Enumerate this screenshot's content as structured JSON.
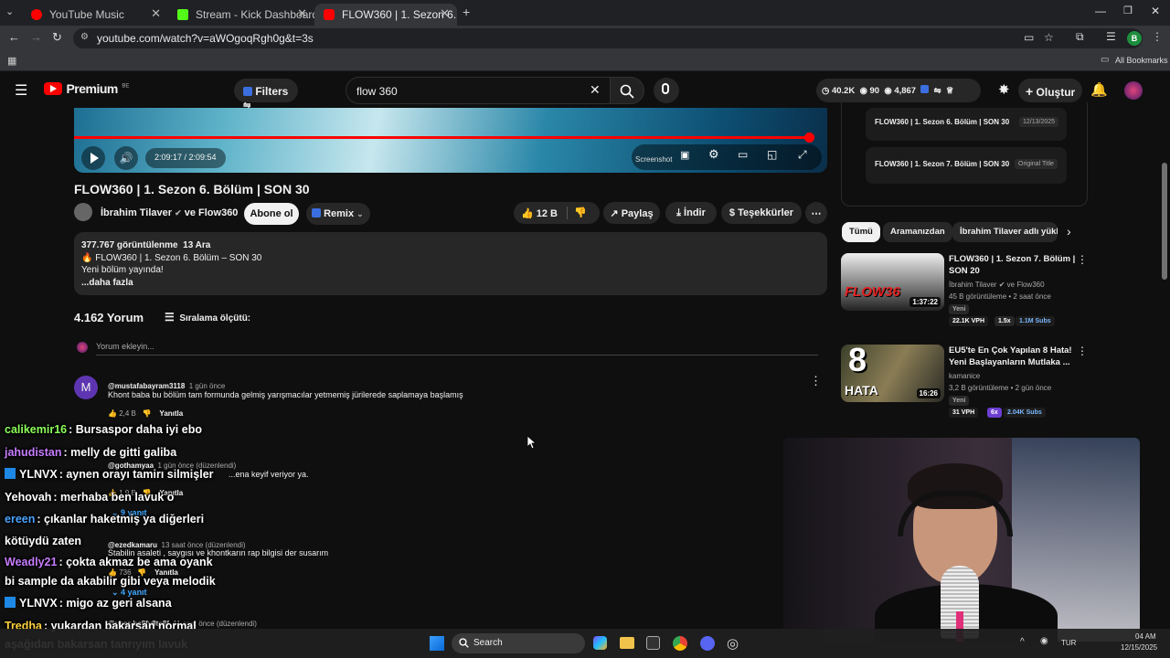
{
  "browser": {
    "tabs": [
      {
        "label": "YouTube Music"
      },
      {
        "label": "Stream - Kick Dashboard"
      },
      {
        "label": "FLOW360 | 1. Sezon 6. Bölüm |"
      }
    ],
    "url": "youtube.com/watch?v=aWOgoqRgh0g&t=3s",
    "bookmarks_label": "All Bookmarks",
    "profile_initial": "B"
  },
  "youtube": {
    "logo_text": "Premium",
    "logo_badge": "BE",
    "filters_label": "Filters",
    "search_value": "flow 360",
    "stats": {
      "views": "40.2K",
      "viewers": "90",
      "count": "4,867"
    },
    "create_label": "Oluştur"
  },
  "player": {
    "time": "2:09:17 / 2:09:54",
    "screenshot_label": "Screenshot",
    "progress_fraction": 0.99
  },
  "video": {
    "title": "FLOW360 | 1. Sezon 6. Bölüm | SON 30",
    "channel": "İbrahim Tilaver",
    "collab": "ve Flow360",
    "subscribe_label": "Abone ol",
    "remix_label": "Remix",
    "likes": "12 B",
    "share_label": "Paylaş",
    "download_label": "İndir",
    "thanks_label": "Teşekkürler"
  },
  "description": {
    "views": "377.767 görüntülenme",
    "date": "13 Ara",
    "line1": "🔥 FLOW360 | 1. Sezon 6. Bölüm – SON 30",
    "line2": "Yeni bölüm yayında!",
    "more": "...daha fazla"
  },
  "comments": {
    "count": "4.162 Yorum",
    "sort_label": "Sıralama ölçütü:",
    "add_placeholder": "Yorum ekleyin...",
    "items": [
      {
        "avatar": "M",
        "user": "@mustafabayram3118",
        "time": "1 gün önce",
        "text": "Khont baba bu bölüm tam formunda gelmiş yarışmacılar yetmemiş jürilerede saplamaya başlamış",
        "likes": "2,4 B",
        "reply": "Yanıtla"
      },
      {
        "user": "@gothamyaa",
        "time": "1 gün önce (düzenlendi)",
        "text": "...ena keyif veriyor ya.",
        "likes": "1,9 B",
        "reply": "Yanıtla",
        "replies": "9 yanıt"
      },
      {
        "user": "@ezedkamaru",
        "time": "13 saat önce (düzenlendi)",
        "text": "Stabilin asaleti , saygısı ve khontkarın rap bilgisi der susarım",
        "likes": "736",
        "reply": "Yanıtla",
        "replies": "4 yanıt"
      },
      {
        "user": "@user-bc8fy8te8f",
        "time": "11 saat önce (düzenlendi)"
      }
    ]
  },
  "chat": [
    {
      "user": "calikemir16",
      "color": "#8cff5a",
      "msg": ": Bursaspor daha iyi ebo",
      "badge": false
    },
    {
      "user": "jahudistan",
      "color": "#c77dff",
      "msg": ": melly de gitti galiba",
      "badge": false
    },
    {
      "user": "YLNVX",
      "color": "#ffffff",
      "msg": ": aynen orayı tamirı silmişler",
      "badge": true
    },
    {
      "user": "Yehovah",
      "color": "#ffffff",
      "msg": ": merhaba ben lavuk o",
      "badge": false
    },
    {
      "user": "ereen",
      "color": "#4aa3ff",
      "msg": ": çıkanlar haketmiş ya diğerleri",
      "badge": false
    },
    {
      "user": "",
      "color": "#ffffff",
      "msg": "kötüydü zaten",
      "badge": false
    },
    {
      "user": "Weadly21",
      "color": "#c77dff",
      "msg": ": çokta akmaz be ama oyank",
      "badge": false
    },
    {
      "user": "",
      "color": "#ffffff",
      "msg": "bi sample da akabilir gibi veya melodik",
      "badge": false
    },
    {
      "user": "YLNVX",
      "color": "#ffffff",
      "msg": ": migo az geri alsana",
      "badge": true
    },
    {
      "user": "Tredha",
      "color": "#ffd23f",
      "msg": ": yukardan bakarsan normal",
      "badge": false
    },
    {
      "user": "",
      "color": "#ffffff",
      "msg": "aşağıdan bakarsan tanrıyım lavuk",
      "badge": false
    }
  ],
  "sidebar": {
    "playlist": [
      {
        "title": "FLOW360 | 1. Sezon 6. Bölüm | SON 30",
        "tag": "12/13/2025"
      },
      {
        "title": "FLOW360 | 1. Sezon 7. Bölüm | SON 30",
        "tag": "Original Title"
      }
    ],
    "chips": [
      "Tümü",
      "Aramanızdan",
      "İbrahim Tilaver adlı yükle"
    ],
    "videos": [
      {
        "title_1": "FLOW360 | 1. Sezon 7. Bölüm |",
        "title_2": "SON 20",
        "channel": "İbrahim Tilaver",
        "collab": "ve Flow360",
        "meta": "45 B görüntüleme • 2 saat önce",
        "badge": "Yeni",
        "duration": "1:37:22",
        "vph": "22.1K VPH",
        "speed": "1.5x",
        "subs": "1.1M Subs",
        "thumb_text": "FLOW36"
      },
      {
        "title_1": "EU5'te En Çok Yapılan 8 Hata!",
        "title_2": "Yeni Başlayanların Mutlaka ...",
        "channel": "kamanice",
        "meta": "3,2 B görüntüleme • 2 gün önce",
        "badge": "Yeni",
        "duration": "16:26",
        "vph": "31 VPH",
        "speed": "6x",
        "subs": "2.04K Subs",
        "thumb_text_1": "8",
        "thumb_text_2": "HATA"
      }
    ]
  },
  "taskbar": {
    "search_label": "Search",
    "lang": "TUR",
    "time": "04 AM",
    "date": "12/15/2025"
  },
  "colors": {
    "accent_red": "#ff0000",
    "bg": "#0f0f0f",
    "surface": "#272727",
    "chat_badge": "#1e88e5"
  }
}
